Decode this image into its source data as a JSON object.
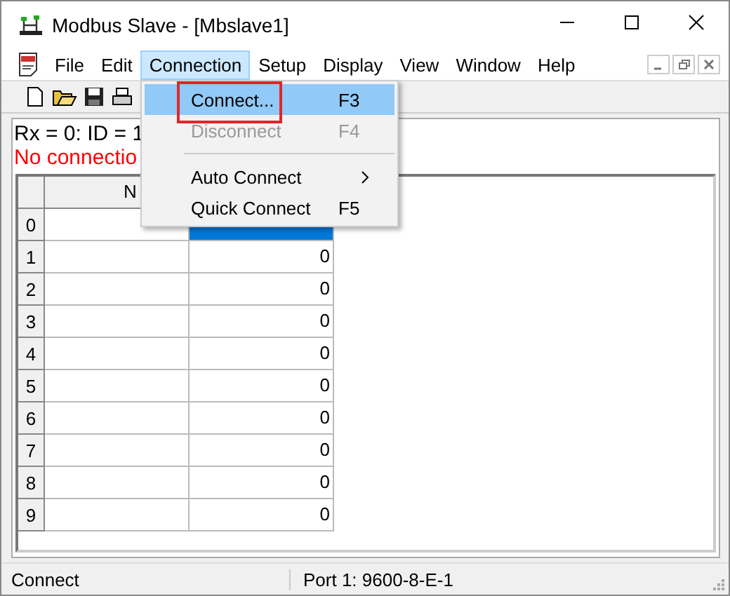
{
  "window": {
    "title": "Modbus Slave - [Mbslave1]"
  },
  "menu_bar": [
    {
      "label": "File",
      "selected": false
    },
    {
      "label": "Edit",
      "selected": false
    },
    {
      "label": "Connection",
      "selected": true
    },
    {
      "label": "Setup",
      "selected": false
    },
    {
      "label": "Display",
      "selected": false
    },
    {
      "label": "View",
      "selected": false
    },
    {
      "label": "Window",
      "selected": false
    },
    {
      "label": "Help",
      "selected": false
    }
  ],
  "connection_menu": [
    {
      "kind": "item",
      "label": "Connect...",
      "shortcut": "F3",
      "selected": true,
      "disabled": false,
      "annotated": true
    },
    {
      "kind": "item",
      "label": "Disconnect",
      "shortcut": "F4",
      "selected": false,
      "disabled": true,
      "annotated": false
    },
    {
      "kind": "separator"
    },
    {
      "kind": "submenu",
      "label": "Auto Connect",
      "selected": false,
      "disabled": false,
      "annotated": false
    },
    {
      "kind": "item",
      "label": "Quick Connect",
      "shortcut": "F5",
      "selected": false,
      "disabled": false,
      "annotated": false
    }
  ],
  "info": {
    "line_1": "Rx = 0: ID = 1",
    "line_2": "No connectio"
  },
  "table": {
    "columns": [
      "N"
    ],
    "rows": [
      {
        "index": "0",
        "selected": true
      },
      {
        "index": "1",
        "value": "0",
        "selected": false
      },
      {
        "index": "2",
        "value": "0",
        "selected": false
      },
      {
        "index": "3",
        "value": "0",
        "selected": false
      },
      {
        "index": "4",
        "value": "0",
        "selected": false
      },
      {
        "index": "5",
        "value": "0",
        "selected": false
      },
      {
        "index": "6",
        "value": "0",
        "selected": false
      },
      {
        "index": "7",
        "value": "0",
        "selected": false
      },
      {
        "index": "8",
        "value": "0",
        "selected": false
      },
      {
        "index": "9",
        "value": "0",
        "selected": false
      }
    ]
  },
  "status_bar": [
    "Connect",
    "Port 1: 9600-8-E-1"
  ]
}
